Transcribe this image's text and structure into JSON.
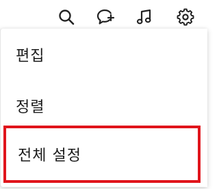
{
  "toolbar": {
    "icons": [
      "search-icon",
      "chat-add-icon",
      "music-icon",
      "gear-icon"
    ]
  },
  "menu": {
    "items": [
      {
        "label": "편집"
      },
      {
        "label": "정렬"
      },
      {
        "label": "전체 설정",
        "highlighted": true
      }
    ]
  },
  "colors": {
    "highlight_border": "#e0141b",
    "icon": "#222222",
    "text": "#1a1a1a"
  }
}
